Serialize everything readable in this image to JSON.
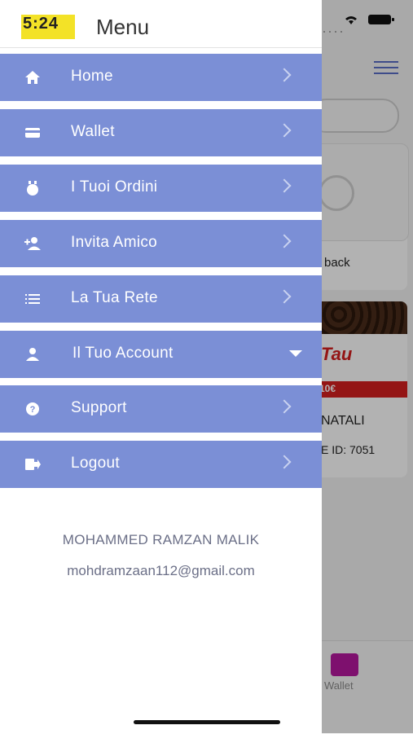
{
  "header": {
    "title": "Menu",
    "logo_text": "5:24"
  },
  "menu": {
    "items": [
      {
        "label": "Home",
        "icon": "home-icon"
      },
      {
        "label": "Wallet",
        "icon": "card-icon"
      },
      {
        "label": "I Tuoi Ordini",
        "icon": "orders-icon"
      },
      {
        "label": "Invita Amico",
        "icon": "add-person-icon"
      },
      {
        "label": "La Tua Rete",
        "icon": "list-icon"
      },
      {
        "label": "Il Tuo Account",
        "icon": "person-icon",
        "expandable": true
      },
      {
        "label": "Support",
        "icon": "help-icon"
      },
      {
        "label": "Logout",
        "icon": "logout-icon"
      }
    ]
  },
  "user": {
    "name": "MOHAMMED RAMZAN MALIK",
    "email": "mohdramzaan112@gmail.com"
  },
  "background": {
    "card1_text": "back",
    "brand_text": "Tau",
    "price_text": "10€",
    "card2_title": "NATALI",
    "card2_id": "E ID: 7051",
    "tab_label": "Wallet"
  },
  "colors": {
    "menu_bg": "#7b8fd6",
    "accent": "#5a6ec6",
    "wallet_tab": "#b5179e"
  }
}
